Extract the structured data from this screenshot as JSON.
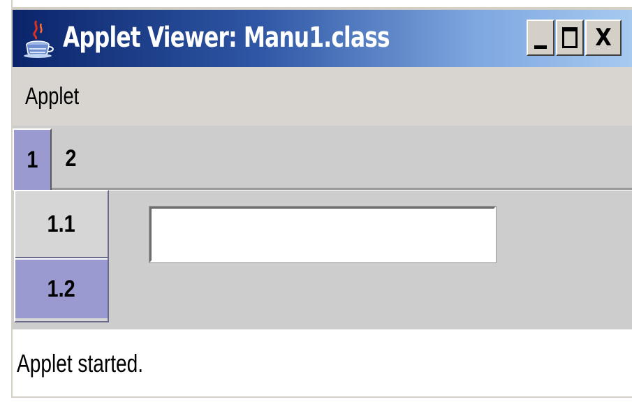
{
  "window": {
    "title": "Applet Viewer: Manu1.class",
    "controls": {
      "minimize": "_",
      "maximize": "□",
      "close": "X"
    }
  },
  "menubar": {
    "items": [
      {
        "label": "Applet"
      }
    ]
  },
  "tabs": {
    "items": [
      {
        "label": "1",
        "selected": true
      },
      {
        "label": "2",
        "selected": false
      }
    ],
    "subtabs": [
      {
        "label": "1.1",
        "selected": false
      },
      {
        "label": "1.2",
        "selected": true
      }
    ]
  },
  "text_field": {
    "value": ""
  },
  "status": {
    "text": "Applet started."
  },
  "colors": {
    "titlebar_start": "#0a246a",
    "titlebar_end": "#a6caf0",
    "selected_tab": "#9a9ad0",
    "panel": "#cdcdcd"
  },
  "icons": {
    "app": "java-coffee-cup-icon"
  }
}
